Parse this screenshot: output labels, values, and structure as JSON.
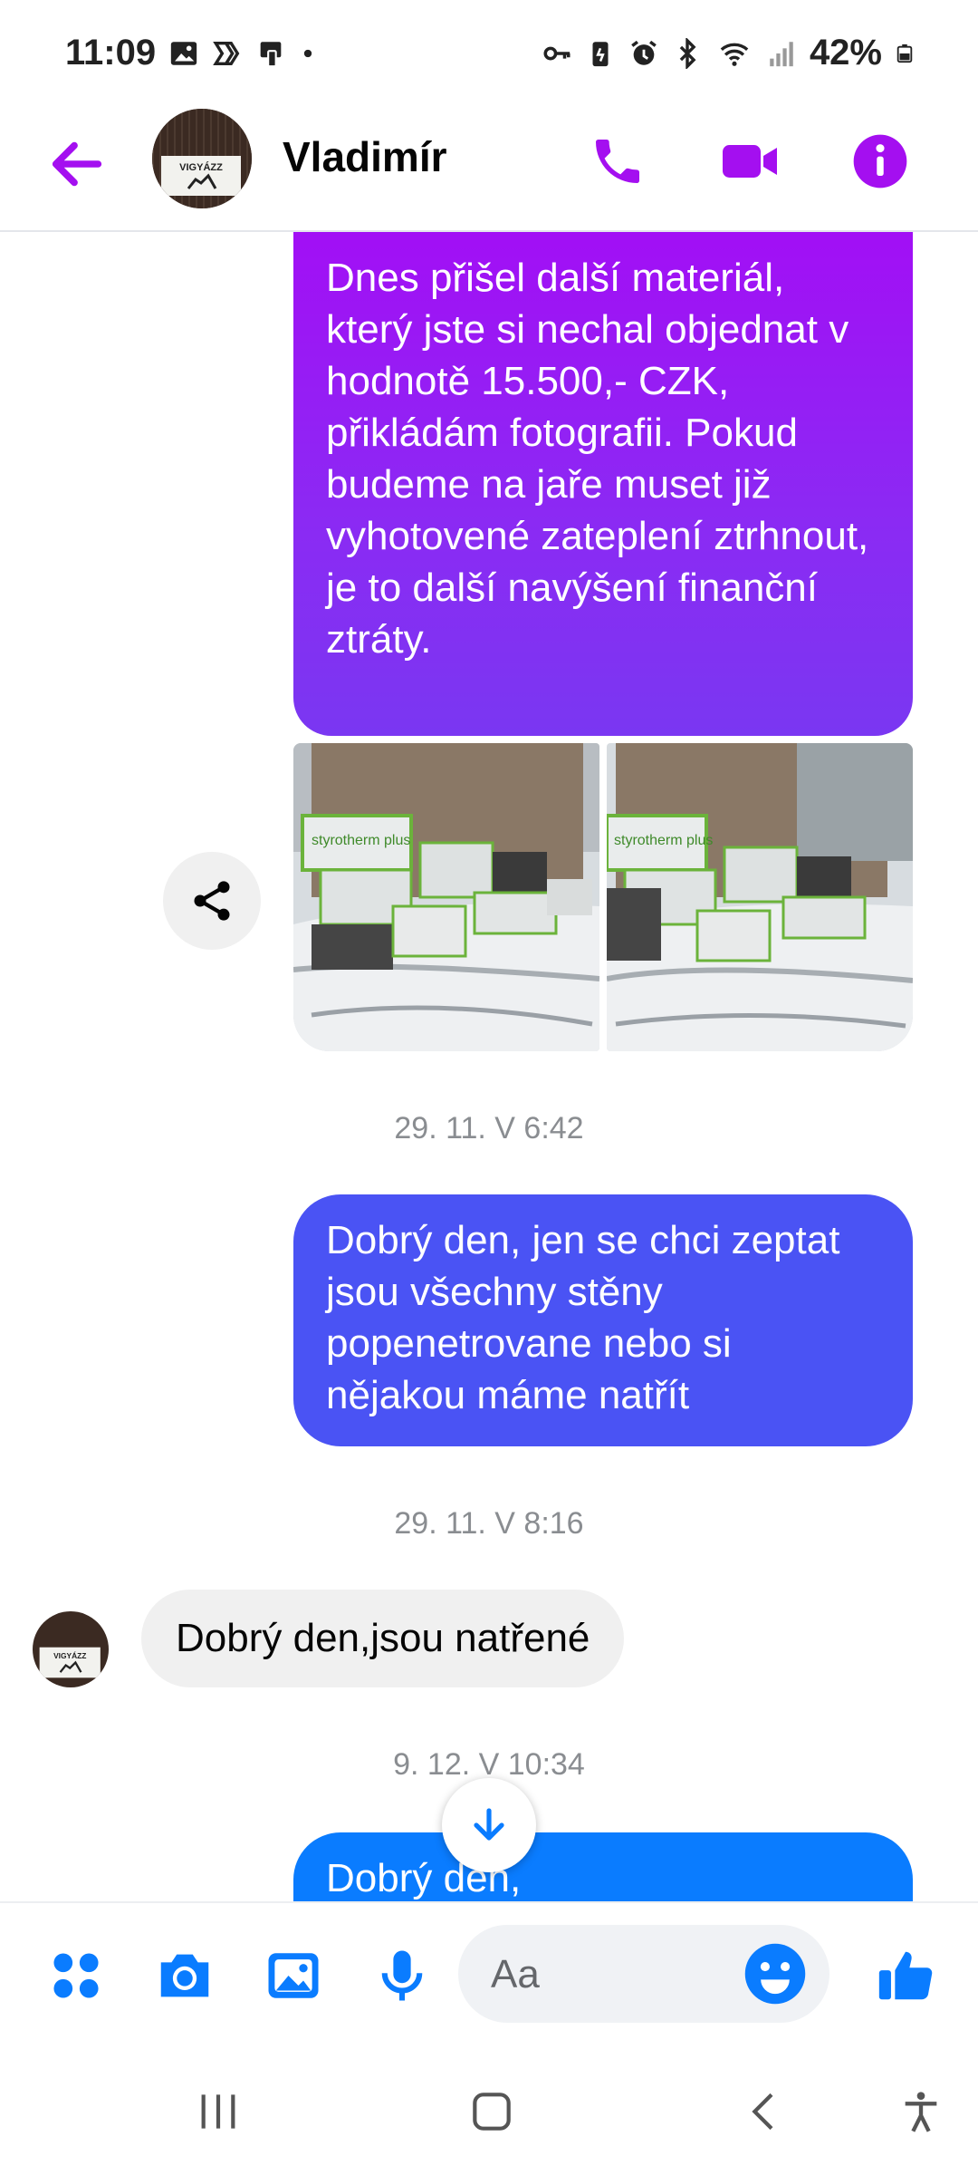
{
  "status_bar": {
    "time": "11:09",
    "battery_percent": "42%"
  },
  "header": {
    "contact_name": "Vladimír",
    "avatar_sign_text": "VIGYÁZZ",
    "accent_color": "#a40ff0"
  },
  "messages": [
    {
      "direction": "outgoing",
      "text": "Dnes přišel další materiál, který jste si nechal objednat v hodnotě 15.500,- CZK, přikládám fotografii. Pokud budeme na jaře muset již vyhotovené zateplení ztrhnout, je to další navýšení finanční ztráty."
    },
    {
      "direction": "outgoing",
      "type": "photos",
      "photos": [
        {
          "description_label": "styrotherm plus"
        },
        {
          "description_label": "styrotherm plus"
        }
      ]
    },
    {
      "type": "timestamp",
      "text": "29. 11. V 6:42"
    },
    {
      "direction": "outgoing",
      "text": "Dobrý den,  jen se chci zeptat jsou všechny stěny popenetrovane nebo si nějakou máme natřít"
    },
    {
      "type": "timestamp",
      "text": "29. 11. V 8:16"
    },
    {
      "direction": "incoming",
      "text": "Dobrý den,jsou natřené"
    },
    {
      "type": "timestamp",
      "text": "9. 12. V 10:34"
    },
    {
      "direction": "outgoing",
      "text": "Dobrý den,"
    }
  ],
  "composer": {
    "placeholder": "Aa",
    "icons": [
      "apps-icon",
      "camera-icon",
      "gallery-icon",
      "microphone-icon",
      "emoji-icon",
      "thumbs-up-icon"
    ]
  },
  "colors": {
    "messenger_blue": "#0a7cff",
    "bubble_purple": "#a20ff5",
    "bubble_indigo": "#4a53f4",
    "incoming_gray": "#f0f0f0"
  }
}
